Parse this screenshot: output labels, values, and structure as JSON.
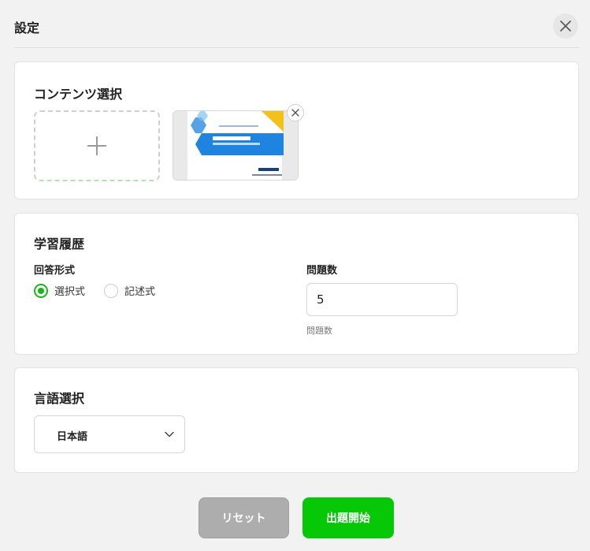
{
  "header": {
    "title": "設定"
  },
  "content_section": {
    "title": "コンテンツ選択"
  },
  "history_section": {
    "title": "学習履歴",
    "answer_format_label": "回答形式",
    "options": [
      {
        "label": "選択式",
        "checked": true
      },
      {
        "label": "記述式",
        "checked": false
      }
    ],
    "question_count_label": "問題数",
    "question_count_value": "5",
    "question_count_hint": "問題数"
  },
  "language_section": {
    "title": "言語選択",
    "selected": "日本語"
  },
  "footer": {
    "reset_label": "リセット",
    "start_label": "出題開始"
  },
  "colors": {
    "accent_green": "#06c806",
    "radio_green": "#19b619",
    "reset_gray": "#adadad",
    "background": "#f2f2f2"
  }
}
